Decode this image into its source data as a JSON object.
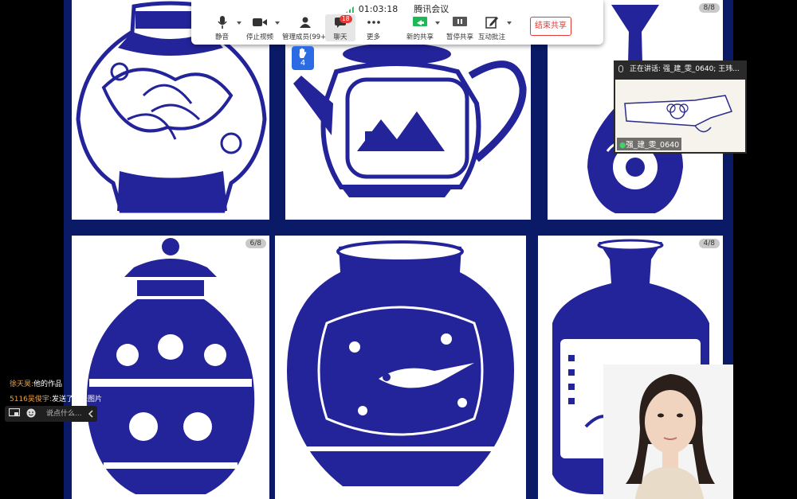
{
  "toolbar": {
    "signal_icon": "signal-icon",
    "elapsed_time": "01:03:18",
    "meeting_name": "腾讯会议",
    "mute_label": "静音",
    "stop_video_label": "停止视频",
    "manage_members_label": "管理成员(99+)",
    "chat_label": "聊天",
    "chat_unread_count": "18",
    "more_label": "更多",
    "new_share_label": "新的共享",
    "pause_share_label": "暂停共享",
    "annotate_label": "互动批注",
    "end_share_label": "结束共享",
    "accent_color": "#e53935",
    "share_icon_color": "#1db954"
  },
  "raise_hand": {
    "icon": "hand-icon",
    "count": "4",
    "color": "#2d6be4"
  },
  "slide": {
    "cards": [
      {
        "name": "vase-phoenix-jar",
        "page": ""
      },
      {
        "name": "vase-teapot",
        "page": ""
      },
      {
        "name": "vase-yuhuchun",
        "page": "8/8"
      },
      {
        "name": "vase-lidded-jar",
        "page": "6/8"
      },
      {
        "name": "vase-bird-jar",
        "page": ""
      },
      {
        "name": "vase-floral-bottle",
        "page": "4/8"
      }
    ],
    "ink_color": "#23239a",
    "background_color": "#0b1a66"
  },
  "speaker_panel": {
    "status_text": "正在讲话: 强_建_雯_0640; 王玮...",
    "name": "强_建_雯_0640"
  },
  "chat": {
    "messages": [
      {
        "sender": "徐天昊:",
        "text": "他的作品"
      },
      {
        "sender": "5116吴俊宇:",
        "text": "发送了一张图片"
      }
    ],
    "input_placeholder": "说点什么..."
  }
}
